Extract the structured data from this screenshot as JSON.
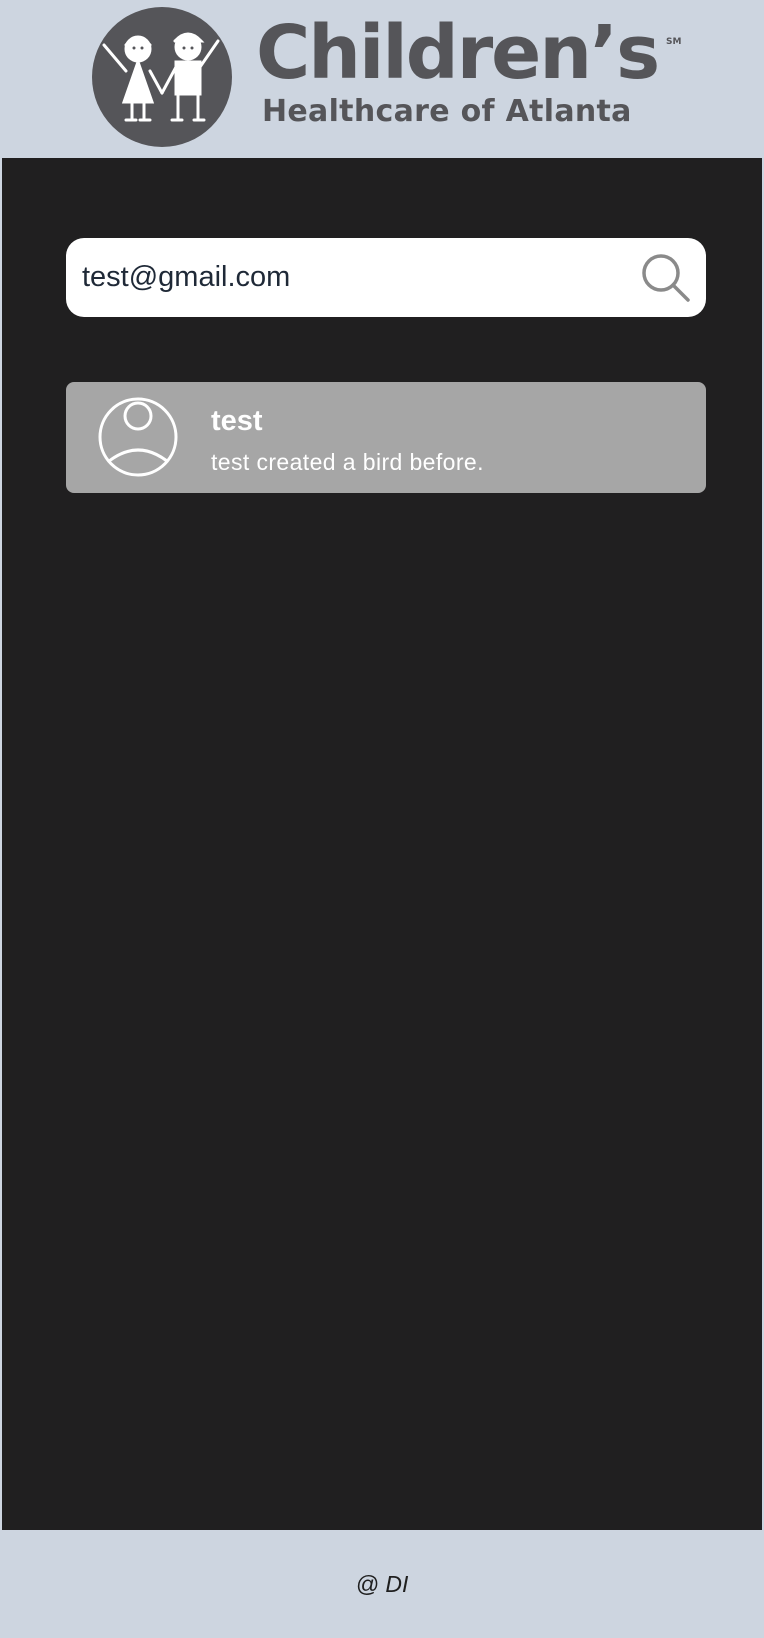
{
  "header": {
    "logo": {
      "title": "Children’s",
      "mark": "SM",
      "subtitle": "Healthcare of Atlanta"
    }
  },
  "search": {
    "value": "test@gmail.com",
    "icon": "search-icon"
  },
  "results": [
    {
      "name": "test",
      "description": "test created a bird before.",
      "icon": "user-avatar-icon"
    }
  ],
  "footer": {
    "text": "@ DI"
  },
  "colors": {
    "page_background": "#cdd5e0",
    "main_background": "#201f20",
    "result_background": "#a6a6a6",
    "logo_gray": "#555559"
  }
}
